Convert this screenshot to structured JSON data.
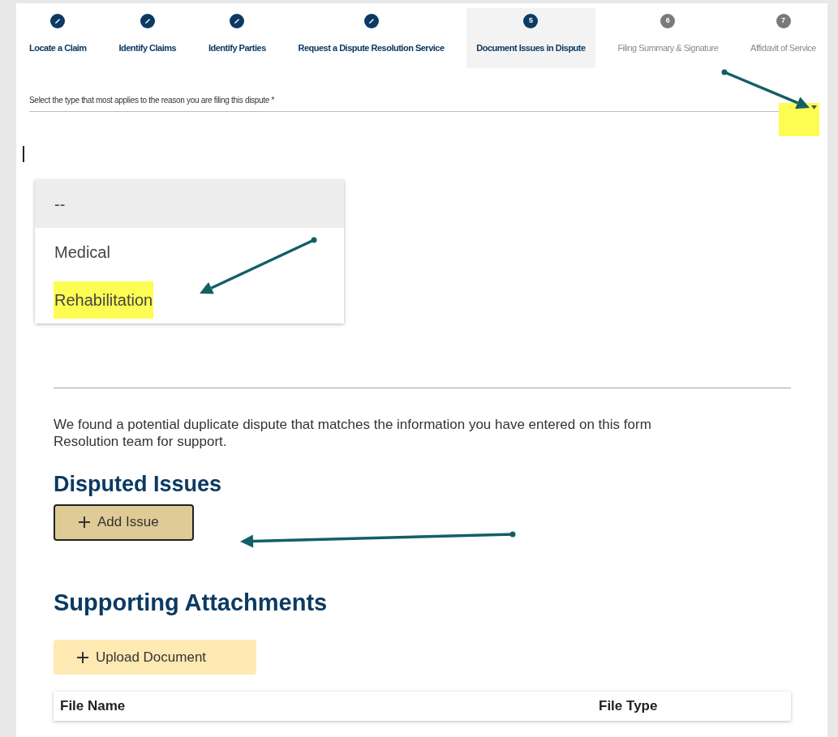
{
  "stepper": {
    "steps": [
      {
        "label": "Locate a Claim",
        "completed": true,
        "selected": false
      },
      {
        "label": "Identify Claims",
        "completed": true,
        "selected": false
      },
      {
        "label": "Identify Parties",
        "completed": true,
        "selected": false
      },
      {
        "label": "Request a Dispute Resolution Service",
        "completed": true,
        "selected": false
      },
      {
        "label": "Document Issues in Dispute",
        "completed": false,
        "number": "5",
        "selected": true
      },
      {
        "label": "Filing Summary & Signature",
        "completed": false,
        "number": "6",
        "selected": false
      },
      {
        "label": "Affidavit of Service",
        "completed": false,
        "number": "7",
        "selected": false
      }
    ]
  },
  "reason_select": {
    "label": "Select the type that most applies to the reason you are filing this dispute *"
  },
  "dropdown": {
    "options": [
      {
        "label": "--",
        "hovered": true,
        "highlighted": false
      },
      {
        "label": "Medical",
        "hovered": false,
        "highlighted": false
      },
      {
        "label": "Rehabilitation",
        "hovered": false,
        "highlighted": true
      }
    ]
  },
  "notice": {
    "lines": [
      "We found a potential duplicate dispute that matches the information you have entered on this form",
      "Resolution team for support."
    ]
  },
  "disputed_issues": {
    "title": "Disputed Issues",
    "button": "Add Issue"
  },
  "attachments": {
    "title": "Supporting Attachments",
    "button": "Upload Document",
    "table": {
      "columns": [
        "File Name",
        "File Type"
      ]
    }
  }
}
